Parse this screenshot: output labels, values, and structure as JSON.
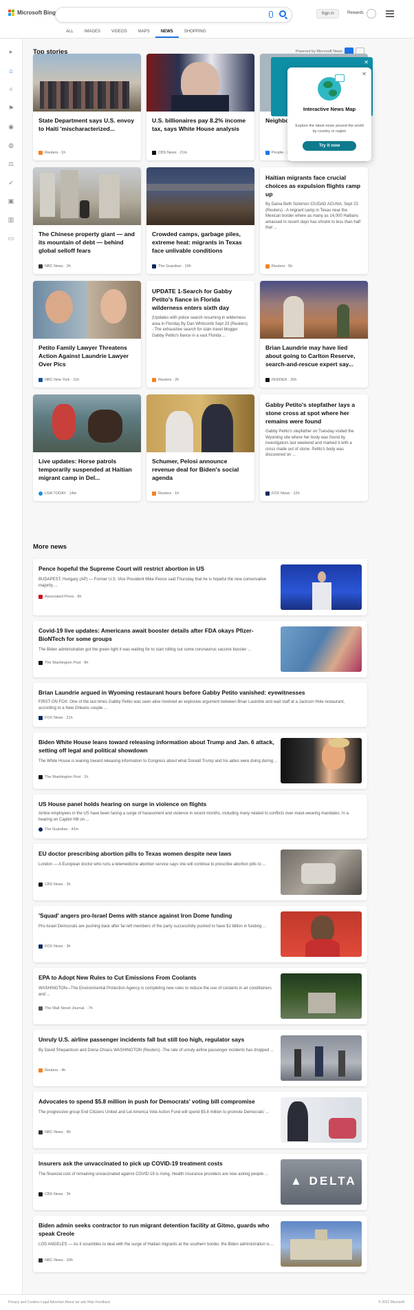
{
  "header": {
    "brand": "Microsoft Bing",
    "signin": "Sign in",
    "rewards": "Rewards"
  },
  "tabs": [
    {
      "label": "ALL"
    },
    {
      "label": "IMAGES"
    },
    {
      "label": "VIDEOS"
    },
    {
      "label": "MAPS"
    },
    {
      "label": "NEWS"
    },
    {
      "label": "SHOPPING"
    }
  ],
  "top": {
    "title": "Top stories",
    "powered": "Powered by Microsoft News"
  },
  "popup": {
    "title": "Interactive News Map",
    "desc": "Explore the latest news around the world by country or region",
    "button": "Try it now"
  },
  "cards": [
    {
      "title": "State Department says U.S. envoy to Haiti 'mischaracterized...",
      "source": "Reuters · 1h",
      "src_color": "#f58220"
    },
    {
      "title": "U.S. billionaires pay 8.2% income tax, says White House analysis",
      "source": "CBS News · 21m",
      "src_color": "#111111"
    },
    {
      "title": "Neighbors ... Funding Camp...",
      "source": "People · 2h",
      "src_color": "#1a73e8"
    },
    {
      "title": "The Chinese property giant — and its mountain of debt — behind global selloff fears",
      "source": "NBC News · 2h",
      "src_color": "#333333"
    },
    {
      "title": "Crowded camps, garbage piles, extreme heat: migrants in Texas face unlivable conditions",
      "source": "The Guardian · 19h",
      "src_color": "#052962"
    },
    {
      "title": "Haitian migrants face crucial choices as expulsion flights ramp up",
      "snippet": "By Daina Beth Solomon CIUDAD ACUNA, Sept 23 (Reuters) - A migrant camp in Texas near the Mexican border where as many as 14,000 Haitians amassed in recent days has shrunk to less than half that ...",
      "source": "Reuters · 5h",
      "src_color": "#f58220"
    },
    {
      "title": "Petito Family Lawyer Threatens Action Against Laundrie Lawyer Over Pics",
      "source": "NBC New York · 11h",
      "src_color": "#1a4fa0"
    },
    {
      "title": "UPDATE 1-Search for Gabby Petito's fiance in Florida wilderness enters sixth day",
      "snippet": "(Updates with police search resuming in wilderness area in Florida) By Dan Whitcomb Sept 23 (Reuters) - The exhaustive search for slain travel blogger Gabby Petito's fiance in a vast Florida ...",
      "source": "Reuters · 2h",
      "src_color": "#f58220"
    },
    {
      "title": "Brian Laundrie may have lied about going to Carlton Reserve, search-and-rescue expert say...",
      "source": "INSIDER · 20h",
      "src_color": "#111111"
    },
    {
      "title": "Live updates: Horse patrols temporarily suspended at Haitian migrant camp in Del...",
      "source": "USA TODAY · 14m",
      "src_color": "#1a8fe3"
    },
    {
      "title": "Schumer, Pelosi announce revenue deal for Biden's social agenda",
      "source": "Reuters · 1h",
      "src_color": "#f58220"
    },
    {
      "title": "Gabby Petito's stepfather lays a stone cross at spot where her remains were found",
      "snippet": "Gabby Petito's stepfather on Tuesday visited the Wyoming site where her body was found by investigators last weekend and marked it with a cross made out of stone. Petito's body was discovered on ...",
      "source": "FOX News · 12h",
      "src_color": "#0b2a5e"
    }
  ],
  "more_title": "More news",
  "more": [
    {
      "title": "Pence hopeful the Supreme Court will restrict abortion in US",
      "snippet": "BUDAPEST, Hungary (AP) — Former U.S. Vice President Mike Pence said Thursday that he is hopeful the new conservative majority ...",
      "source": "Associated Press · 6h",
      "src_color": "#d0021b"
    },
    {
      "title": "Covid-19 live updates: Americans await booster details after FDA okays Pfizer-BioNTech for some groups",
      "snippet": "The Biden administration got the green light it was waiting for to start rolling out some coronavirus vaccine booster ...",
      "source": "The Washington Post · 8h",
      "src_color": "#111111"
    },
    {
      "title": "Brian Laundrie argued in Wyoming restaurant hours before Gabby Petito vanished: eyewitnesses",
      "snippet": "FIRST ON FOX: One of the last times Gabby Petito was seen alive involved an explosive argument between Brian Laundrie and wait staff at a Jackson Hole restaurant, according to a New Orleans couple ...",
      "source": "FOX News · 21h",
      "src_color": "#0b2a5e"
    },
    {
      "title": "Biden White House leans toward releasing information about Trump and Jan. 6 attack, setting off legal and political showdown",
      "snippet": "The White House is leaning toward releasing information to Congress about what Donald Trump and his aides were doing during ...",
      "source": "The Washington Post · 1h",
      "src_color": "#111111"
    },
    {
      "title": "US House panel holds hearing on surge in violence on flights",
      "snippet": "Airline employees in the US have been facing a surge of harassment and violence in recent months, including many related to conflicts over mask-wearing mandates. In a hearing on Capitol Hill on ...",
      "source": "The Guardian · 42m",
      "src_color": "#052962"
    },
    {
      "title": "EU doctor prescribing abortion pills to Texas women despite new laws",
      "snippet": "London — A European doctor who runs a telemedicine abortion service says she will continue to prescribe abortion pills to ...",
      "source": "CBS News · 2h",
      "src_color": "#111111"
    },
    {
      "title": "'Squad' angers pro-Israel Dems with stance against Iron Dome funding",
      "snippet": "Pro-Israel Democrats are pushing back after far-left members of the party successfully pushed to have $1 billion in funding ...",
      "source": "FOX News · 3h",
      "src_color": "#0b2a5e"
    },
    {
      "title": "EPA to Adopt New Rules to Cut Emissions From Coolants",
      "snippet": "WASHINGTON—The Environmental Protection Agency is completing new rules to reduce the use of coolants in air conditioners and ...",
      "source": "The Wall Street Journal. · 7h",
      "src_color": "#555555"
    },
    {
      "title": "Unruly U.S. airline passenger incidents fall but still too high, regulator says",
      "snippet": "By David Shepardson and Doina Chiacu WASHINGTON (Reuters) -The rate of unruly airline passenger incidents has dropped ...",
      "source": "Reuters · 4h",
      "src_color": "#f58220"
    },
    {
      "title": "Advocates to spend $5.8 million in push for Democrats' voting bill compromise",
      "snippet": "The progressive group End Citizens United and Let America Vote Action Fund will spend $5.8 million to promote Democrats' ...",
      "source": "NBC News · 8h",
      "src_color": "#333333"
    },
    {
      "title": "Insurers ask the unvaccinated to pick up COVID-19 treatment costs",
      "snippet": "The financial cost of remaining unvaccinated against COVID-19 is rising. Health insurance providers are now asking people ...",
      "source": "CBS News · 2h",
      "src_color": "#111111"
    },
    {
      "title": "Biden admin seeks contractor to run migrant detention facility at Gitmo, guards who speak Creole",
      "snippet": "LOS ANGELES — As it scrambles to deal with the surge of Haitian migrants at the southern border, the Biden administration is ...",
      "source": "NBC News · 20h",
      "src_color": "#333333"
    }
  ],
  "footer": {
    "left": "Privacy and Cookies   Legal   Advertise   About our ads   Help   Feedback",
    "right": "© 2021 Microsoft"
  },
  "colors": {
    "accent": "#1a73e8",
    "teal": "#0e7a8c"
  },
  "icons": [
    "microsoft-logo-icon",
    "mic-icon",
    "search-icon",
    "trophy-icon",
    "hamburger-menu-icon",
    "home-icon",
    "globe-icon"
  ]
}
